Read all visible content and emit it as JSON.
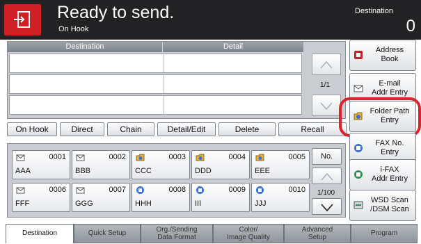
{
  "header": {
    "title": "Ready to send.",
    "subtitle": "On Hook",
    "destination_label": "Destination",
    "destination_count": "0"
  },
  "dest_table": {
    "col_destination": "Destination",
    "col_detail": "Detail",
    "page_indicator": "1/1"
  },
  "actions": {
    "on_hook": "On Hook",
    "direct": "Direct",
    "chain": "Chain",
    "detail_edit": "Detail/Edit",
    "delete": "Delete",
    "recall": "Recall"
  },
  "one_touch": {
    "no_label": "No.",
    "page_indicator": "1/100",
    "keys": [
      {
        "number": "0001",
        "name": "AAA",
        "icon": "email-icon"
      },
      {
        "number": "0002",
        "name": "BBB",
        "icon": "email-icon"
      },
      {
        "number": "0003",
        "name": "CCC",
        "icon": "folder-icon"
      },
      {
        "number": "0004",
        "name": "DDD",
        "icon": "folder-icon"
      },
      {
        "number": "0005",
        "name": "EEE",
        "icon": "folder-icon"
      },
      {
        "number": "0006",
        "name": "FFF",
        "icon": "email-icon"
      },
      {
        "number": "0007",
        "name": "GGG",
        "icon": "email-icon"
      },
      {
        "number": "0008",
        "name": "HHH",
        "icon": "fax-icon"
      },
      {
        "number": "0009",
        "name": "III",
        "icon": "fax-icon"
      },
      {
        "number": "0010",
        "name": "JJJ",
        "icon": "fax-icon"
      }
    ]
  },
  "side_buttons": {
    "address_book": "Address\nBook",
    "email_entry": "E-mail\nAddr Entry",
    "folder_path": "Folder Path\nEntry",
    "fax_no": "FAX No.\nEntry",
    "ifax": "i-FAX\nAddr Entry",
    "wsd_scan": "WSD Scan\n/DSM Scan"
  },
  "tabs": {
    "destination": "Destination",
    "quick_setup": "Quick Setup",
    "org_sending_1": "Org./Sending",
    "org_sending_2": "Data Format",
    "color_1": "Color/",
    "color_2": "Image Quality",
    "advanced_1": "Advanced",
    "advanced_2": "Setup",
    "program": "Program"
  },
  "colors": {
    "header_bg": "#222124",
    "home_red": "#d11f26",
    "highlight_red": "#d9242c"
  }
}
